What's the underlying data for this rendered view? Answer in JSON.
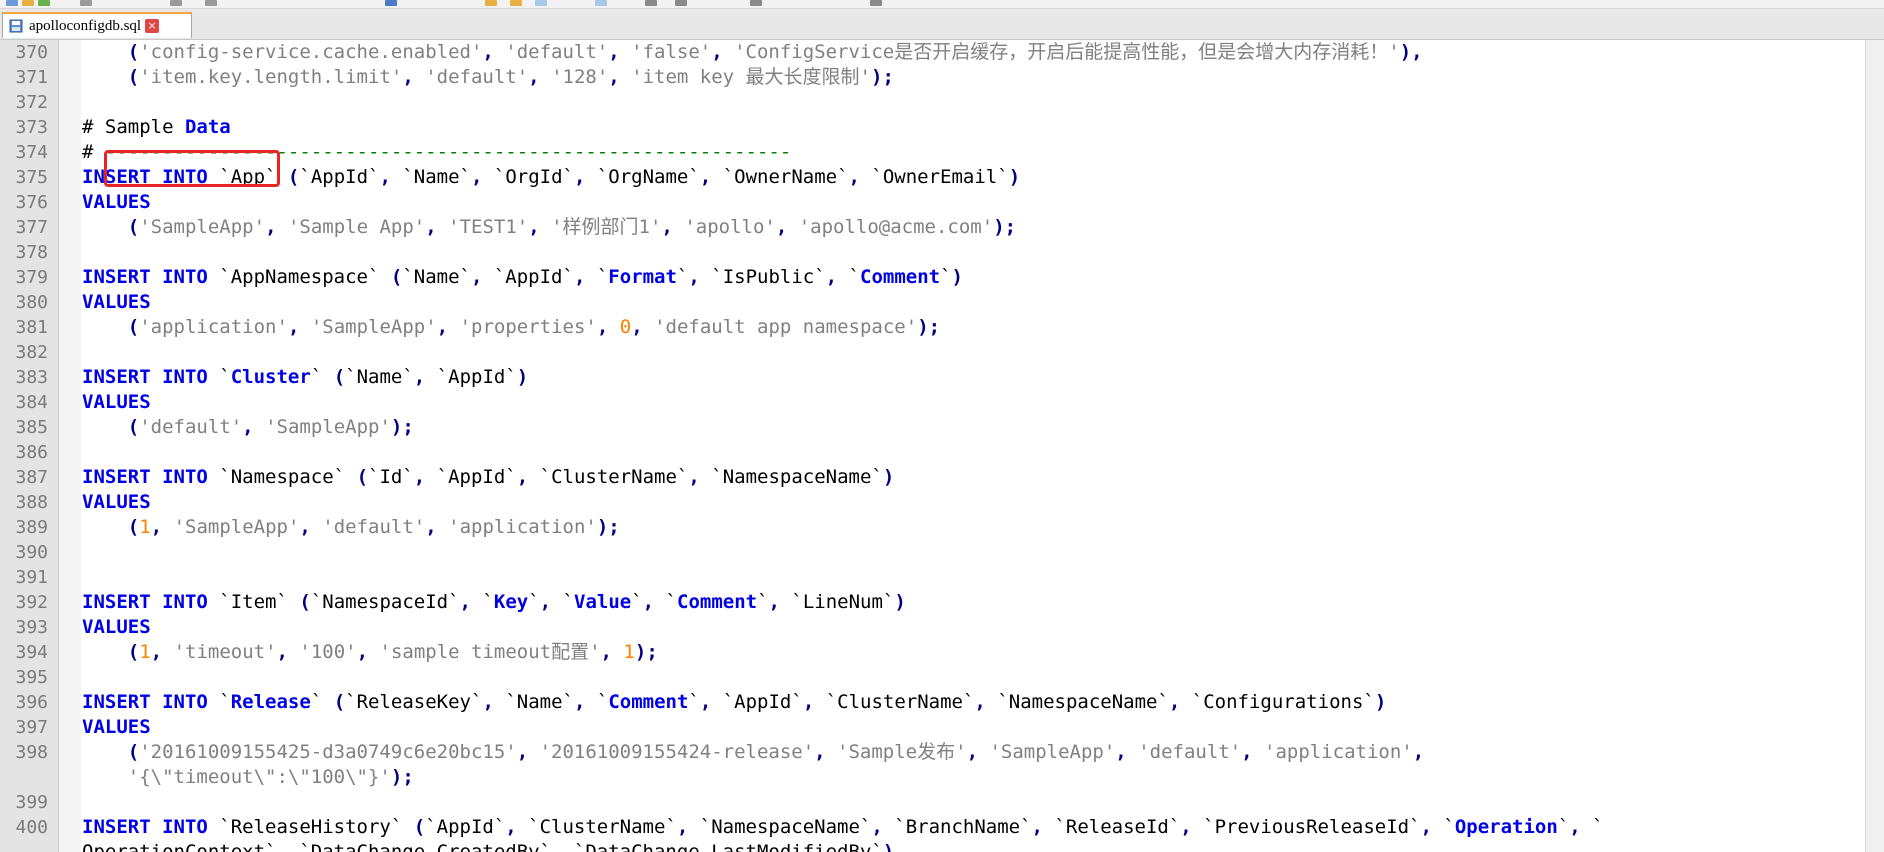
{
  "tab": {
    "filename": "apolloconfigdb.sql",
    "close_symbol": "×"
  },
  "colors": {
    "keyword": "#0000e6",
    "string": "#808080",
    "number": "#ff8000",
    "highlight": "#e82424"
  },
  "lines": [
    {
      "n": "370",
      "tokens": [
        [
          "s",
          "    "
        ],
        [
          "op",
          "("
        ],
        [
          "str",
          "'config-service.cache.enabled'"
        ],
        [
          "op",
          ", "
        ],
        [
          "str",
          "'default'"
        ],
        [
          "op",
          ", "
        ],
        [
          "str",
          "'false'"
        ],
        [
          "op",
          ", "
        ],
        [
          "str",
          "'ConfigService是否开启缓存，开启后能提高性能，但是会增大内存消耗！'"
        ],
        [
          "op",
          "),"
        ]
      ]
    },
    {
      "n": "371",
      "tokens": [
        [
          "s",
          "    "
        ],
        [
          "op",
          "("
        ],
        [
          "str",
          "'item.key.length.limit'"
        ],
        [
          "op",
          ", "
        ],
        [
          "str",
          "'default'"
        ],
        [
          "op",
          ", "
        ],
        [
          "str",
          "'128'"
        ],
        [
          "op",
          ", "
        ],
        [
          "str",
          "'item key 最大长度限制'"
        ],
        [
          "op",
          ");"
        ]
      ]
    },
    {
      "n": "372",
      "tokens": []
    },
    {
      "n": "373",
      "tokens": [
        [
          "t",
          "# "
        ],
        [
          "t",
          "Sample "
        ],
        [
          "kw",
          "Data"
        ]
      ]
    },
    {
      "n": "374",
      "tokens": [
        [
          "t",
          "# "
        ],
        [
          "cmt",
          "------------------------------------------------------------"
        ]
      ]
    },
    {
      "n": "375",
      "tokens": [
        [
          "kw",
          "INSERT INTO "
        ],
        [
          "t",
          "`App` "
        ],
        [
          "op",
          "("
        ],
        [
          "t",
          "`AppId`"
        ],
        [
          "op",
          ", "
        ],
        [
          "t",
          "`Name`"
        ],
        [
          "op",
          ", "
        ],
        [
          "t",
          "`OrgId`"
        ],
        [
          "op",
          ", "
        ],
        [
          "t",
          "`OrgName`"
        ],
        [
          "op",
          ", "
        ],
        [
          "t",
          "`OwnerName`"
        ],
        [
          "op",
          ", "
        ],
        [
          "t",
          "`OwnerEmail`"
        ],
        [
          "op",
          ")"
        ]
      ]
    },
    {
      "n": "376",
      "tokens": [
        [
          "kw",
          "VALUES"
        ]
      ]
    },
    {
      "n": "377",
      "tokens": [
        [
          "s",
          "    "
        ],
        [
          "op",
          "("
        ],
        [
          "str",
          "'SampleApp'"
        ],
        [
          "op",
          ", "
        ],
        [
          "str",
          "'Sample App'"
        ],
        [
          "op",
          ", "
        ],
        [
          "str",
          "'TEST1'"
        ],
        [
          "op",
          ", "
        ],
        [
          "str",
          "'样例部门1'"
        ],
        [
          "op",
          ", "
        ],
        [
          "str",
          "'apollo'"
        ],
        [
          "op",
          ", "
        ],
        [
          "str",
          "'apollo@acme.com'"
        ],
        [
          "op",
          ");"
        ]
      ]
    },
    {
      "n": "378",
      "tokens": []
    },
    {
      "n": "379",
      "tokens": [
        [
          "kw",
          "INSERT INTO "
        ],
        [
          "t",
          "`AppNamespace` "
        ],
        [
          "op",
          "("
        ],
        [
          "t",
          "`Name`"
        ],
        [
          "op",
          ", "
        ],
        [
          "t",
          "`AppId`"
        ],
        [
          "op",
          ", "
        ],
        [
          "t",
          "`"
        ],
        [
          "kw",
          "Format"
        ],
        [
          "t",
          "`"
        ],
        [
          "op",
          ", "
        ],
        [
          "t",
          "`IsPublic`"
        ],
        [
          "op",
          ", "
        ],
        [
          "t",
          "`"
        ],
        [
          "kw",
          "Comment"
        ],
        [
          "t",
          "`"
        ],
        [
          "op",
          ")"
        ]
      ]
    },
    {
      "n": "380",
      "tokens": [
        [
          "kw",
          "VALUES"
        ]
      ]
    },
    {
      "n": "381",
      "tokens": [
        [
          "s",
          "    "
        ],
        [
          "op",
          "("
        ],
        [
          "str",
          "'application'"
        ],
        [
          "op",
          ", "
        ],
        [
          "str",
          "'SampleApp'"
        ],
        [
          "op",
          ", "
        ],
        [
          "str",
          "'properties'"
        ],
        [
          "op",
          ", "
        ],
        [
          "num",
          "0"
        ],
        [
          "op",
          ", "
        ],
        [
          "str",
          "'default app namespace'"
        ],
        [
          "op",
          ");"
        ]
      ]
    },
    {
      "n": "382",
      "tokens": []
    },
    {
      "n": "383",
      "tokens": [
        [
          "kw",
          "INSERT INTO "
        ],
        [
          "t",
          "`"
        ],
        [
          "kw",
          "Cluster"
        ],
        [
          "t",
          "` "
        ],
        [
          "op",
          "("
        ],
        [
          "t",
          "`Name`"
        ],
        [
          "op",
          ", "
        ],
        [
          "t",
          "`AppId`"
        ],
        [
          "op",
          ")"
        ]
      ]
    },
    {
      "n": "384",
      "tokens": [
        [
          "kw",
          "VALUES"
        ]
      ]
    },
    {
      "n": "385",
      "tokens": [
        [
          "s",
          "    "
        ],
        [
          "op",
          "("
        ],
        [
          "str",
          "'default'"
        ],
        [
          "op",
          ", "
        ],
        [
          "str",
          "'SampleApp'"
        ],
        [
          "op",
          ");"
        ]
      ]
    },
    {
      "n": "386",
      "tokens": []
    },
    {
      "n": "387",
      "tokens": [
        [
          "kw",
          "INSERT INTO "
        ],
        [
          "t",
          "`Namespace` "
        ],
        [
          "op",
          "("
        ],
        [
          "t",
          "`Id`"
        ],
        [
          "op",
          ", "
        ],
        [
          "t",
          "`AppId`"
        ],
        [
          "op",
          ", "
        ],
        [
          "t",
          "`ClusterName`"
        ],
        [
          "op",
          ", "
        ],
        [
          "t",
          "`NamespaceName`"
        ],
        [
          "op",
          ")"
        ]
      ]
    },
    {
      "n": "388",
      "tokens": [
        [
          "kw",
          "VALUES"
        ]
      ]
    },
    {
      "n": "389",
      "tokens": [
        [
          "s",
          "    "
        ],
        [
          "op",
          "("
        ],
        [
          "num",
          "1"
        ],
        [
          "op",
          ", "
        ],
        [
          "str",
          "'SampleApp'"
        ],
        [
          "op",
          ", "
        ],
        [
          "str",
          "'default'"
        ],
        [
          "op",
          ", "
        ],
        [
          "str",
          "'application'"
        ],
        [
          "op",
          ");"
        ]
      ]
    },
    {
      "n": "390",
      "tokens": []
    },
    {
      "n": "391",
      "tokens": []
    },
    {
      "n": "392",
      "tokens": [
        [
          "kw",
          "INSERT INTO "
        ],
        [
          "t",
          "`Item` "
        ],
        [
          "op",
          "("
        ],
        [
          "t",
          "`NamespaceId`"
        ],
        [
          "op",
          ", "
        ],
        [
          "t",
          "`"
        ],
        [
          "kw",
          "Key"
        ],
        [
          "t",
          "`"
        ],
        [
          "op",
          ", "
        ],
        [
          "t",
          "`"
        ],
        [
          "kw",
          "Value"
        ],
        [
          "t",
          "`"
        ],
        [
          "op",
          ", "
        ],
        [
          "t",
          "`"
        ],
        [
          "kw",
          "Comment"
        ],
        [
          "t",
          "`"
        ],
        [
          "op",
          ", "
        ],
        [
          "t",
          "`LineNum`"
        ],
        [
          "op",
          ")"
        ]
      ]
    },
    {
      "n": "393",
      "tokens": [
        [
          "kw",
          "VALUES"
        ]
      ]
    },
    {
      "n": "394",
      "tokens": [
        [
          "s",
          "    "
        ],
        [
          "op",
          "("
        ],
        [
          "num",
          "1"
        ],
        [
          "op",
          ", "
        ],
        [
          "str",
          "'timeout'"
        ],
        [
          "op",
          ", "
        ],
        [
          "str",
          "'100'"
        ],
        [
          "op",
          ", "
        ],
        [
          "str",
          "'sample timeout配置'"
        ],
        [
          "op",
          ", "
        ],
        [
          "num",
          "1"
        ],
        [
          "op",
          ");"
        ]
      ]
    },
    {
      "n": "395",
      "tokens": []
    },
    {
      "n": "396",
      "tokens": [
        [
          "kw",
          "INSERT INTO "
        ],
        [
          "t",
          "`"
        ],
        [
          "kw",
          "Release"
        ],
        [
          "t",
          "` "
        ],
        [
          "op",
          "("
        ],
        [
          "t",
          "`ReleaseKey`"
        ],
        [
          "op",
          ", "
        ],
        [
          "t",
          "`Name`"
        ],
        [
          "op",
          ", "
        ],
        [
          "t",
          "`"
        ],
        [
          "kw",
          "Comment"
        ],
        [
          "t",
          "`"
        ],
        [
          "op",
          ", "
        ],
        [
          "t",
          "`AppId`"
        ],
        [
          "op",
          ", "
        ],
        [
          "t",
          "`ClusterName`"
        ],
        [
          "op",
          ", "
        ],
        [
          "t",
          "`NamespaceName`"
        ],
        [
          "op",
          ", "
        ],
        [
          "t",
          "`Configurations`"
        ],
        [
          "op",
          ")"
        ]
      ]
    },
    {
      "n": "397",
      "tokens": [
        [
          "kw",
          "VALUES"
        ]
      ]
    },
    {
      "n": "398",
      "tokens": [
        [
          "s",
          "    "
        ],
        [
          "op",
          "("
        ],
        [
          "str",
          "'20161009155425-d3a0749c6e20bc15'"
        ],
        [
          "op",
          ", "
        ],
        [
          "str",
          "'20161009155424-release'"
        ],
        [
          "op",
          ", "
        ],
        [
          "str",
          "'Sample发布'"
        ],
        [
          "op",
          ", "
        ],
        [
          "str",
          "'SampleApp'"
        ],
        [
          "op",
          ", "
        ],
        [
          "str",
          "'default'"
        ],
        [
          "op",
          ", "
        ],
        [
          "str",
          "'application'"
        ],
        [
          "op",
          ","
        ]
      ]
    },
    {
      "n": "",
      "tokens": [
        [
          "s",
          "    "
        ],
        [
          "str",
          "'{\\\"timeout\\\":\\\"100\\\"}'"
        ],
        [
          "op",
          ");"
        ]
      ]
    },
    {
      "n": "399",
      "tokens": []
    },
    {
      "n": "400",
      "tokens": [
        [
          "kw",
          "INSERT INTO "
        ],
        [
          "t",
          "`ReleaseHistory` "
        ],
        [
          "op",
          "("
        ],
        [
          "t",
          "`AppId`"
        ],
        [
          "op",
          ", "
        ],
        [
          "t",
          "`ClusterName`"
        ],
        [
          "op",
          ", "
        ],
        [
          "t",
          "`NamespaceName`"
        ],
        [
          "op",
          ", "
        ],
        [
          "t",
          "`BranchName`"
        ],
        [
          "op",
          ", "
        ],
        [
          "t",
          "`ReleaseId`"
        ],
        [
          "op",
          ", "
        ],
        [
          "t",
          "`PreviousReleaseId`"
        ],
        [
          "op",
          ", "
        ],
        [
          "t",
          "`"
        ],
        [
          "kw",
          "Operation"
        ],
        [
          "t",
          "`"
        ],
        [
          "op",
          ", "
        ],
        [
          "t",
          "`"
        ]
      ]
    },
    {
      "n": "",
      "tokens": [
        [
          "t",
          "OperationContext`"
        ],
        [
          "op",
          ", "
        ],
        [
          "t",
          "`DataChange_CreatedBy`"
        ],
        [
          "op",
          ", "
        ],
        [
          "t",
          "`DataChange_LastModifiedBy`"
        ],
        [
          "op",
          ")"
        ]
      ]
    }
  ]
}
